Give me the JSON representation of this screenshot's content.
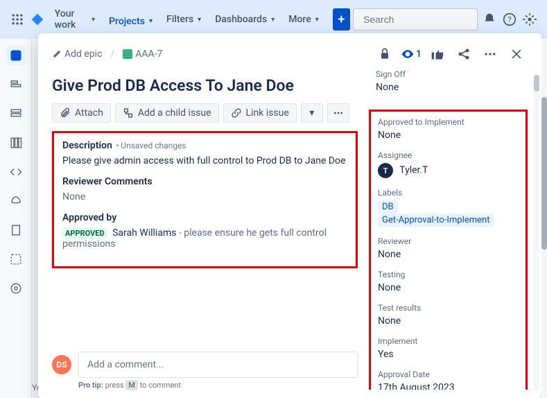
{
  "nav": {
    "your_work": "Your work",
    "projects": "Projects",
    "filters": "Filters",
    "dashboards": "Dashboards",
    "more": "More",
    "search_placeholder": "Search"
  },
  "background_footer": "You're in a team-managed project",
  "breadcrumb": {
    "add_epic": "Add epic",
    "issue_key": "AAA-7"
  },
  "watch_count": "1",
  "title": "Give Prod DB Access To Jane Doe",
  "actions": {
    "attach": "Attach",
    "add_child": "Add a child issue",
    "link_issue": "Link issue"
  },
  "description": {
    "label": "Description",
    "unsaved": "• Unsaved changes",
    "text": "Please give admin access with full control to Prod DB to  Jane Doe"
  },
  "reviewer_comments": {
    "label": "Reviewer Comments",
    "value": "None"
  },
  "approved_by": {
    "label": "Approved by",
    "badge": "APPROVED",
    "name": "Sarah Williams",
    "note": "- please ensure he gets full control permissions"
  },
  "comment": {
    "placeholder": "Add a comment...",
    "avatar_initials": "DS",
    "protip_prefix": "Pro tip: ",
    "protip_mid": "press",
    "protip_key": "M",
    "protip_suffix": "to comment"
  },
  "side_top": {
    "signoff_label": "Sign Off",
    "signoff_value": "None"
  },
  "side": {
    "approved_impl_label": "Approved to Implement",
    "approved_impl_value": "None",
    "assignee_label": "Assignee",
    "assignee_initial": "T",
    "assignee_name": "Tyler.T",
    "labels_label": "Labels",
    "label_chip_1": "DB",
    "label_chip_2": "Get-Approval-to-Implement",
    "reviewer_label": "Reviewer",
    "reviewer_value": "None",
    "testing_label": "Testing",
    "testing_value": "None",
    "test_results_label": "Test results",
    "test_results_value": "None",
    "implement_label": "Implement",
    "implement_value": "Yes",
    "approval_date_label": "Approval Date",
    "approval_date_value": "17th August 2023"
  }
}
